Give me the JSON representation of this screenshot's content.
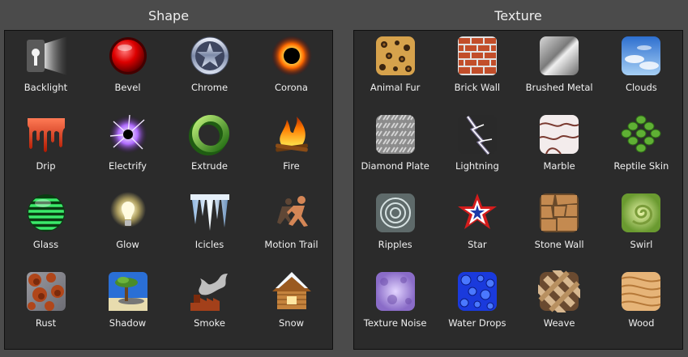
{
  "shape": {
    "title": "Shape",
    "items": [
      {
        "label": "Backlight",
        "icon": "backlight-icon"
      },
      {
        "label": "Bevel",
        "icon": "bevel-icon"
      },
      {
        "label": "Chrome",
        "icon": "chrome-icon"
      },
      {
        "label": "Corona",
        "icon": "corona-icon"
      },
      {
        "label": "Drip",
        "icon": "drip-icon"
      },
      {
        "label": "Electrify",
        "icon": "electrify-icon"
      },
      {
        "label": "Extrude",
        "icon": "extrude-icon"
      },
      {
        "label": "Fire",
        "icon": "fire-icon"
      },
      {
        "label": "Glass",
        "icon": "glass-icon"
      },
      {
        "label": "Glow",
        "icon": "glow-icon"
      },
      {
        "label": "Icicles",
        "icon": "icicles-icon"
      },
      {
        "label": "Motion Trail",
        "icon": "motion-trail-icon"
      },
      {
        "label": "Rust",
        "icon": "rust-icon"
      },
      {
        "label": "Shadow",
        "icon": "shadow-icon"
      },
      {
        "label": "Smoke",
        "icon": "smoke-icon"
      },
      {
        "label": "Snow",
        "icon": "snow-icon"
      }
    ]
  },
  "texture": {
    "title": "Texture",
    "items": [
      {
        "label": "Animal Fur",
        "icon": "animal-fur-icon"
      },
      {
        "label": "Brick Wall",
        "icon": "brick-wall-icon"
      },
      {
        "label": "Brushed Metal",
        "icon": "brushed-metal-icon"
      },
      {
        "label": "Clouds",
        "icon": "clouds-icon"
      },
      {
        "label": "Diamond Plate",
        "icon": "diamond-plate-icon"
      },
      {
        "label": "Lightning",
        "icon": "lightning-icon"
      },
      {
        "label": "Marble",
        "icon": "marble-icon"
      },
      {
        "label": "Reptile Skin",
        "icon": "reptile-skin-icon"
      },
      {
        "label": "Ripples",
        "icon": "ripples-icon"
      },
      {
        "label": "Star",
        "icon": "star-icon"
      },
      {
        "label": "Stone Wall",
        "icon": "stone-wall-icon"
      },
      {
        "label": "Swirl",
        "icon": "swirl-icon"
      },
      {
        "label": "Texture Noise",
        "icon": "texture-noise-icon"
      },
      {
        "label": "Water Drops",
        "icon": "water-drops-icon"
      },
      {
        "label": "Weave",
        "icon": "weave-icon"
      },
      {
        "label": "Wood",
        "icon": "wood-icon"
      }
    ]
  }
}
